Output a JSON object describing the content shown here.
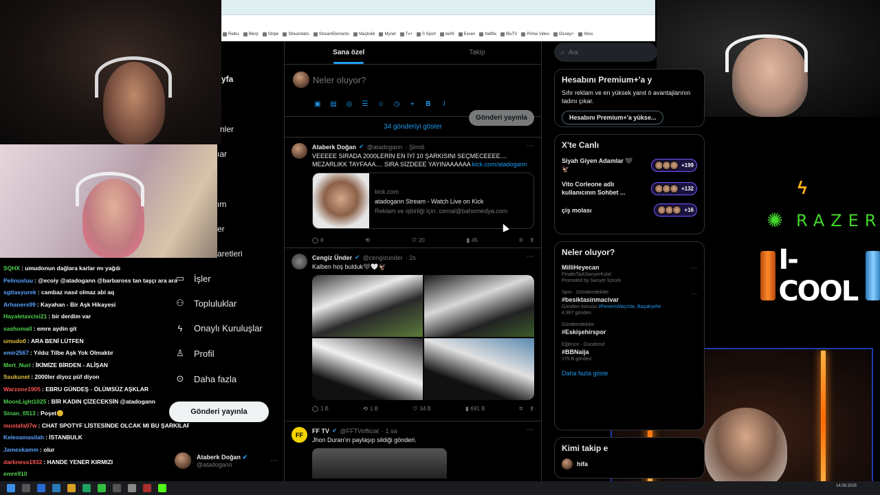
{
  "browser": {
    "bookmarks": [
      "Reibu",
      "Blerp",
      "Stripe",
      "Streamlabs",
      "StreamElements",
      "Maçkolik",
      "Mynet",
      "Tv+",
      "S Sport",
      "beIN",
      "Exxen",
      "Netflix",
      "BluTV",
      "Prime Video",
      "Disney+",
      "Xbox"
    ]
  },
  "x": {
    "tabs": [
      "Sana özel",
      "Takip"
    ],
    "composer": {
      "placeholder": "Neler oluyor?",
      "post_button": "Gönderi yayınla"
    },
    "show_more": "34 gönderiyi göster",
    "tweets": [
      {
        "name": "Ataberk Doğan",
        "handle": "@atadogann",
        "time": "· Şimdi",
        "text": "VEEEEE SIRADA 2000LERİN EN İYİ 10 ŞARKISINI SEÇMECEEEE.... MEZARLIKK TAYFAAA.... SIRA SİZDEEE YAYINAAAAAA",
        "link": "kick.com/atadogann",
        "card": {
          "domain": "kick.com",
          "title": "atadogann Stream - Watch Live on Kick",
          "desc": "Reklam ve işbirliği için: cemal@bahomedya.com"
        },
        "replies": "8",
        "reposts": "",
        "likes": "20",
        "views": "45"
      },
      {
        "name": "Cengiz Ünder",
        "handle": "@cengizunder",
        "time": "· 2s",
        "text": "Kalben hoş bulduk🖤🤍🦅",
        "replies": "1 B",
        "reposts": "1 B",
        "likes": "34 B",
        "views": "691 B"
      },
      {
        "name": "FF TV",
        "handle": "@FFTVofficial",
        "time": "· 1 sa",
        "text": "Jhon Duran'ın paylaşıp sildiği gönderi.",
        "logo": "FF"
      }
    ]
  },
  "right": {
    "search_placeholder": "Ara",
    "premium": {
      "title": "Hesabını Premium+'a y",
      "text": "Sıfır reklam ve en yüksek yanıt ö avantajlarının tadını çıkar.",
      "button": "Hesabını Premium+'a yükse..."
    },
    "live": {
      "title": "X'te Canlı",
      "items": [
        {
          "name": "Siyah Giyen Adamlar 🖤🦅",
          "count": "+199"
        },
        {
          "name": "Vito Corleone adlı kullanıcının Sohbet ...",
          "count": "+132"
        },
        {
          "name": "çiş molası",
          "count": "+16"
        }
      ]
    },
    "trends": {
      "title": "Neler oluyor?",
      "items": [
        {
          "meta": "",
          "title": "MilliHeyecan",
          "sub": "FinalinTadıSarıyerKola!",
          "sub2": "Promoted by Sarıyer İçecek"
        },
        {
          "meta": "Spor · Gündemdekiler",
          "title": "#besiktasinmacivar",
          "sub": "Gündem konusu",
          "sub_link": "#FenerinMaçıVar, Başakşehir",
          "sub2": "4.997 gönderi"
        },
        {
          "meta": "Gündemdekiler",
          "title": "#Eskişehirspor",
          "sub": "",
          "sub2": ""
        },
        {
          "meta": "Eğlence · Gündemd",
          "title": "#BBNaija",
          "sub": "",
          "sub2": "175 B gönderi"
        }
      ],
      "show_all": "Daha fazla göste"
    },
    "follow": {
      "title": "Kimi takip e",
      "first": "hifa"
    }
  },
  "nav": {
    "fragments": [
      "yfa",
      "nler",
      "ıar",
      "ım",
      "er",
      "aretleri"
    ],
    "items": [
      "İşler",
      "Topluluklar",
      "Onaylı Kuruluşlar",
      "Profil",
      "Daha fazla"
    ],
    "post_button": "Gönderi yayınla",
    "profile": {
      "name": "Ataberk Doğan",
      "handle": "@atadogann"
    }
  },
  "chat": [
    {
      "user": "SQHX",
      "color": "#4fd14f",
      "msg": "umudonun dağlara karlar mı yağdı"
    },
    {
      "user": "Pelinusluu",
      "color": "#5aa0ff",
      "msg": "@ecoiy @atadogann @barbaross tan taşçı ara ara"
    },
    {
      "user": "sgttasyurek",
      "color": "#5aa0ff",
      "msg": "cambaz nasıl olmaz abi aq"
    },
    {
      "user": "Arhaners99",
      "color": "#5aa0ff",
      "msg": "Kayahan - Bir Aşk Hikayesi"
    },
    {
      "user": "Hayaletavcisi21",
      "color": "#4fd14f",
      "msg": "bir derdim var"
    },
    {
      "user": "sashomall",
      "color": "#4fd14f",
      "msg": "emre aydin git"
    },
    {
      "user": "umudo0",
      "color": "#e0c040",
      "msg": "ARA BENİ LÜTFEN"
    },
    {
      "user": "emir2567",
      "color": "#5aa0ff",
      "msg": "Yıldız Tilbe Aşk Yok Olmaktır"
    },
    {
      "user": "Mert_Nuri",
      "color": "#4fd14f",
      "msg": "İKİMİZE BİRDEN - ALİŞAN"
    },
    {
      "user": "Ssukunet",
      "color": "#e0c040",
      "msg": "2000ler diyoz püf diyon"
    },
    {
      "user": "Warzone1905",
      "color": "#ff5555",
      "msg": "EBRU GÜNDEŞ - ÖLÜMSÜZ AŞKLAR"
    },
    {
      "user": "MoonLight1025",
      "color": "#4fd14f",
      "msg": "BİR KADIN ÇİZECEKSİN @atadogann"
    },
    {
      "user": "Sinan_0513",
      "color": "#4fd14f",
      "msg": "Poşet😊"
    },
    {
      "user": "mustafa07w",
      "color": "#ff5555",
      "msg": "CHAT SPOTYF LİSTESİNDE OLCAK MI BU ŞARKILAR"
    },
    {
      "user": "Kelesamasilah",
      "color": "#5aa0ff",
      "msg": "İSTANBULK"
    },
    {
      "user": "Jameskamm",
      "color": "#5aa0ff",
      "msg": "olur"
    },
    {
      "user": "darkness1932",
      "color": "#ff5555",
      "msg": "HANDE YENER KIRMIZI"
    },
    {
      "user": "emre910",
      "color": "#4fd14f",
      "msg": ""
    }
  ],
  "sponsors": {
    "razer": "RAZER",
    "icool": "I-COOL"
  },
  "taskbar": {
    "clock": "14.09.2025"
  },
  "colors": {
    "accent": "#1d9bf0",
    "live_border": "#7856ff",
    "razer_green": "#44d62c"
  }
}
